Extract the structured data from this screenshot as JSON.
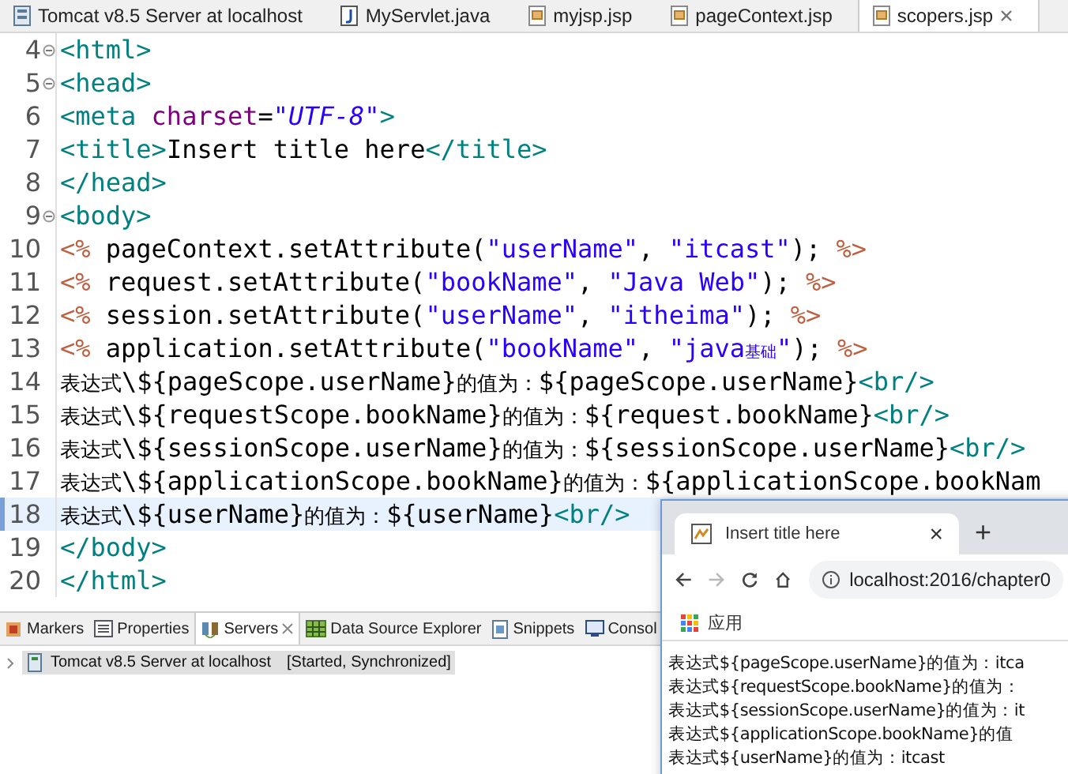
{
  "editor_tabs": [
    {
      "label": "Tomcat v8.5 Server at localhost",
      "kind": "server",
      "selected": false
    },
    {
      "label": "MyServlet.java",
      "kind": "java",
      "selected": false
    },
    {
      "label": "myjsp.jsp",
      "kind": "jsp",
      "selected": false
    },
    {
      "label": "pageContext.jsp",
      "kind": "jsp",
      "selected": false
    },
    {
      "label": "scopers.jsp",
      "kind": "jsp",
      "selected": true
    }
  ],
  "editor": {
    "lines": [
      {
        "number": "4",
        "fold": true,
        "current": false,
        "tokens": [
          {
            "kind": "tag",
            "text": "<html>"
          }
        ]
      },
      {
        "number": "5",
        "fold": true,
        "current": false,
        "tokens": [
          {
            "kind": "tag",
            "text": "<head>"
          }
        ]
      },
      {
        "number": "6",
        "fold": false,
        "current": false,
        "tokens": [
          {
            "kind": "tag",
            "text": "<meta "
          },
          {
            "kind": "attr",
            "text": "charset"
          },
          {
            "kind": "code",
            "text": "="
          },
          {
            "kind": "value",
            "text": "\"UTF-8\""
          },
          {
            "kind": "tag",
            "text": ">"
          }
        ]
      },
      {
        "number": "7",
        "fold": false,
        "current": false,
        "tokens": [
          {
            "kind": "tag",
            "text": "<title>"
          },
          {
            "kind": "code",
            "text": "Insert title here"
          },
          {
            "kind": "tag",
            "text": "</title>"
          }
        ]
      },
      {
        "number": "8",
        "fold": false,
        "current": false,
        "tokens": [
          {
            "kind": "tag",
            "text": "</head>"
          }
        ]
      },
      {
        "number": "9",
        "fold": true,
        "current": false,
        "tokens": [
          {
            "kind": "tag",
            "text": "<body>"
          }
        ]
      },
      {
        "number": "10",
        "fold": false,
        "current": false,
        "tokens": [
          {
            "kind": "jsp",
            "text": "<%"
          },
          {
            "kind": "code",
            "text": " pageContext.setAttribute("
          },
          {
            "kind": "str",
            "text": "\"userName\""
          },
          {
            "kind": "code",
            "text": ", "
          },
          {
            "kind": "str",
            "text": "\"itcast\""
          },
          {
            "kind": "code",
            "text": "); "
          },
          {
            "kind": "jsp",
            "text": "%>"
          }
        ]
      },
      {
        "number": "11",
        "fold": false,
        "current": false,
        "tokens": [
          {
            "kind": "jsp",
            "text": "<%"
          },
          {
            "kind": "code",
            "text": " request.setAttribute("
          },
          {
            "kind": "str",
            "text": "\"bookName\""
          },
          {
            "kind": "code",
            "text": ", "
          },
          {
            "kind": "str",
            "text": "\"Java Web\""
          },
          {
            "kind": "code",
            "text": "); "
          },
          {
            "kind": "jsp",
            "text": "%>"
          }
        ]
      },
      {
        "number": "12",
        "fold": false,
        "current": false,
        "tokens": [
          {
            "kind": "jsp",
            "text": "<%"
          },
          {
            "kind": "code",
            "text": " session.setAttribute("
          },
          {
            "kind": "str",
            "text": "\"userName\""
          },
          {
            "kind": "code",
            "text": ", "
          },
          {
            "kind": "str",
            "text": "\"itheima\""
          },
          {
            "kind": "code",
            "text": "); "
          },
          {
            "kind": "jsp",
            "text": "%>"
          }
        ]
      },
      {
        "number": "13",
        "fold": false,
        "current": false,
        "tokens": [
          {
            "kind": "jsp",
            "text": "<%"
          },
          {
            "kind": "code",
            "text": " application.setAttribute("
          },
          {
            "kind": "str",
            "text": "\"bookName\""
          },
          {
            "kind": "code",
            "text": ", "
          },
          {
            "kind": "str",
            "text": "\"java"
          },
          {
            "kind": "cjk_str",
            "text": "基础"
          },
          {
            "kind": "str",
            "text": "\""
          },
          {
            "kind": "code",
            "text": "); "
          },
          {
            "kind": "jsp",
            "text": "%>"
          }
        ]
      },
      {
        "number": "14",
        "fold": false,
        "current": false,
        "tokens": [
          {
            "kind": "cjk",
            "text": "表达式"
          },
          {
            "kind": "code",
            "text": "\\${pageScope.userName}"
          },
          {
            "kind": "cjk",
            "text": "的值为："
          },
          {
            "kind": "code",
            "text": "${pageScope.userName}"
          },
          {
            "kind": "tag",
            "text": "<br/>"
          }
        ]
      },
      {
        "number": "15",
        "fold": false,
        "current": false,
        "tokens": [
          {
            "kind": "cjk",
            "text": "表达式"
          },
          {
            "kind": "code",
            "text": "\\${requestScope.bookName}"
          },
          {
            "kind": "cjk",
            "text": "的值为："
          },
          {
            "kind": "code",
            "text": "${request.bookName}"
          },
          {
            "kind": "tag",
            "text": "<br/>"
          }
        ]
      },
      {
        "number": "16",
        "fold": false,
        "current": false,
        "tokens": [
          {
            "kind": "cjk",
            "text": "表达式"
          },
          {
            "kind": "code",
            "text": "\\${sessionScope.userName}"
          },
          {
            "kind": "cjk",
            "text": "的值为："
          },
          {
            "kind": "code",
            "text": "${sessionScope.userName}"
          },
          {
            "kind": "tag",
            "text": "<br/>"
          }
        ]
      },
      {
        "number": "17",
        "fold": false,
        "current": false,
        "tokens": [
          {
            "kind": "cjk",
            "text": "表达式"
          },
          {
            "kind": "code",
            "text": "\\${applicationScope.bookName}"
          },
          {
            "kind": "cjk",
            "text": "的值为："
          },
          {
            "kind": "code",
            "text": "${applicationScope.bookNam"
          }
        ]
      },
      {
        "number": "18",
        "fold": false,
        "current": true,
        "tokens": [
          {
            "kind": "cjk",
            "text": "表达式"
          },
          {
            "kind": "code",
            "text": "\\${userName}"
          },
          {
            "kind": "cjk",
            "text": "的值为："
          },
          {
            "kind": "code",
            "text": "${userName}"
          },
          {
            "kind": "tag",
            "text": "<br/>"
          }
        ]
      },
      {
        "number": "19",
        "fold": false,
        "current": false,
        "tokens": [
          {
            "kind": "tag",
            "text": "</body>"
          }
        ]
      },
      {
        "number": "20",
        "fold": false,
        "current": false,
        "tokens": [
          {
            "kind": "tag",
            "text": "</html>"
          }
        ]
      }
    ]
  },
  "bottom_panel": {
    "tabs": [
      {
        "label": "Markers",
        "kind": "markers",
        "selected": false
      },
      {
        "label": "Properties",
        "kind": "properties",
        "selected": false
      },
      {
        "label": "Servers",
        "kind": "servers",
        "selected": true
      },
      {
        "label": "Data Source Explorer",
        "kind": "datasource",
        "selected": false
      },
      {
        "label": "Snippets",
        "kind": "snippets",
        "selected": false
      },
      {
        "label": "Consol",
        "kind": "console",
        "selected": false
      }
    ],
    "servers": [
      {
        "name": "Tomcat v8.5 Server at localhost",
        "status": "[Started, Synchronized]"
      }
    ]
  },
  "browser": {
    "tab_title": "Insert title here",
    "close": "×",
    "new_tab": "+",
    "forward_disabled": true,
    "address": "localhost:2016/chapter0",
    "bookmarks": [
      {
        "label": "应用"
      }
    ],
    "content": [
      "表达式${pageScope.userName}的值为：itca",
      "表达式${requestScope.bookName}的值为：",
      "表达式${sessionScope.userName}的值为：it",
      "表达式${applicationScope.bookName}的值",
      "表达式${userName}的值为：itcast"
    ]
  }
}
